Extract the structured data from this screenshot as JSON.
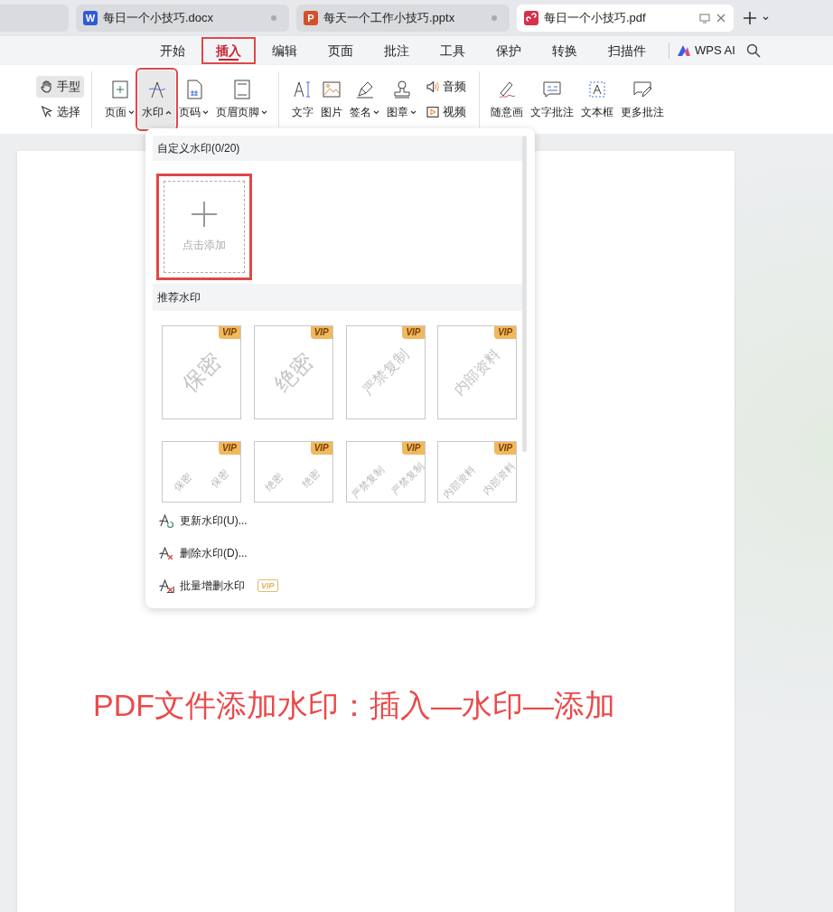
{
  "tabs": [
    {
      "kind": "blank",
      "selected": false
    },
    {
      "kind": "word",
      "badge": "W",
      "label": "每日一个小技巧.docx",
      "selected": false
    },
    {
      "kind": "ppt",
      "badge": "P",
      "label": "每天一个工作小技巧.pptx",
      "selected": false
    },
    {
      "kind": "pdf",
      "label": "每日一个小技巧.pdf",
      "selected": true
    }
  ],
  "menu": [
    {
      "label": "开始",
      "selected": false,
      "highlighted": false
    },
    {
      "label": "插入",
      "selected": true,
      "highlighted": true
    },
    {
      "label": "编辑",
      "selected": false,
      "highlighted": false
    },
    {
      "label": "页面",
      "selected": false,
      "highlighted": false
    },
    {
      "label": "批注",
      "selected": false,
      "highlighted": false
    },
    {
      "label": "工具",
      "selected": false,
      "highlighted": false
    },
    {
      "label": "保护",
      "selected": false,
      "highlighted": false
    },
    {
      "label": "转换",
      "selected": false,
      "highlighted": false
    },
    {
      "label": "扫描件",
      "selected": false,
      "highlighted": false
    }
  ],
  "wps_ai": "WPS AI",
  "ribbon": [
    {
      "kind": "stack",
      "items": [
        {
          "label": "手型",
          "selected": true
        },
        {
          "label": "选择",
          "selected": false
        }
      ]
    },
    {
      "kind": "big",
      "items": [
        {
          "label": "页面",
          "dropdown": true,
          "expanded": false,
          "selected": false,
          "highlighted": false
        },
        {
          "label": "水印",
          "dropdown": true,
          "expanded": true,
          "selected": true,
          "highlighted": true
        },
        {
          "label": "页码",
          "dropdown": true,
          "expanded": false,
          "selected": false,
          "highlighted": false
        },
        {
          "label": "页眉页脚",
          "dropdown": true,
          "expanded": false,
          "selected": false,
          "highlighted": false
        }
      ]
    },
    {
      "kind": "big",
      "items": [
        {
          "label": "文字",
          "dropdown": false,
          "selected": false,
          "highlighted": false
        },
        {
          "label": "图片",
          "dropdown": false,
          "selected": false,
          "highlighted": false
        },
        {
          "label": "签名",
          "dropdown": true,
          "expanded": false,
          "selected": false,
          "highlighted": false
        },
        {
          "label": "图章",
          "dropdown": true,
          "expanded": false,
          "selected": false,
          "highlighted": false
        }
      ]
    },
    {
      "kind": "stack",
      "items": [
        {
          "label": "音频",
          "selected": false
        },
        {
          "label": "视频",
          "selected": false
        }
      ]
    },
    {
      "kind": "big",
      "items": [
        {
          "label": "随意画",
          "dropdown": false,
          "selected": false,
          "highlighted": false
        },
        {
          "label": "文字批注",
          "dropdown": false,
          "selected": false,
          "highlighted": false
        },
        {
          "label": "文本框",
          "dropdown": false,
          "selected": false,
          "highlighted": false
        },
        {
          "label": "更多批注",
          "dropdown": false,
          "selected": false,
          "highlighted": false
        }
      ]
    }
  ],
  "dropdown": {
    "custom_title": "自定义水印(0/20)",
    "add_label": "点击添加",
    "add_highlighted": true,
    "recommended_title": "推荐水印",
    "presets": [
      {
        "kind": "single",
        "texts": [
          "保密"
        ],
        "badge": "VIP"
      },
      {
        "kind": "single",
        "texts": [
          "绝密"
        ],
        "badge": "VIP"
      },
      {
        "kind": "single",
        "texts": [
          "严禁复制"
        ],
        "badge": "VIP"
      },
      {
        "kind": "single",
        "texts": [
          "内部资料"
        ],
        "badge": "VIP"
      },
      {
        "kind": "tiled",
        "texts": [
          "保密",
          "保密"
        ],
        "badge": "VIP"
      },
      {
        "kind": "tiled",
        "texts": [
          "绝密",
          "绝密"
        ],
        "badge": "VIP"
      },
      {
        "kind": "tiled",
        "texts": [
          "严禁复制",
          "严禁复制"
        ],
        "badge": "VIP"
      },
      {
        "kind": "tiled",
        "texts": [
          "内部资料",
          "内部资料"
        ],
        "badge": "VIP"
      }
    ],
    "actions": [
      {
        "label": "更新水印(U)..."
      },
      {
        "label": "删除水印(D)..."
      },
      {
        "label": "批量增删水印",
        "badge": "VIP"
      }
    ]
  },
  "document": {
    "caption": "PDF文件添加水印：插入—水印—添加"
  }
}
